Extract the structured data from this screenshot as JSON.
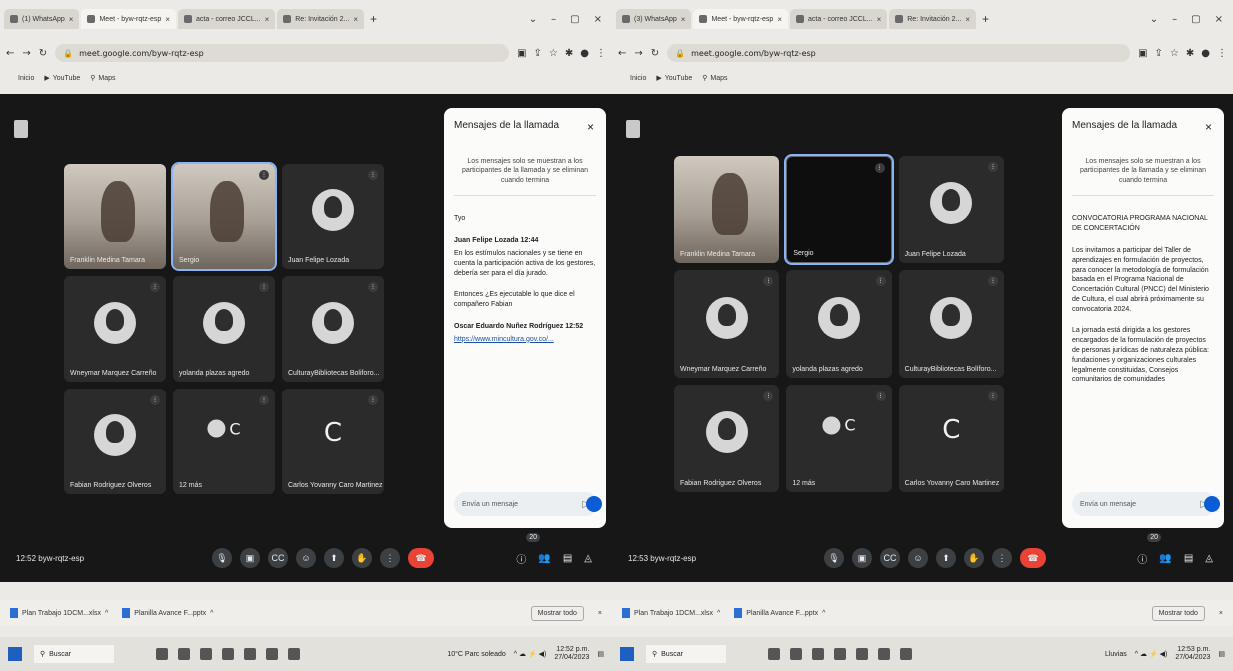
{
  "left": {
    "tabs": [
      {
        "label": "(1) WhatsApp"
      },
      {
        "label": "Meet - byw-rqtz-esp"
      },
      {
        "label": "acta - correo JCCL..."
      },
      {
        "label": "Re: Invitación 2..."
      }
    ],
    "url": "meet.google.com/byw-rqtz-esp",
    "bookmarks": [
      {
        "label": "Inicio"
      },
      {
        "label": "YouTube"
      },
      {
        "label": "Maps"
      }
    ],
    "participants": [
      {
        "name": "Franklin Medina Tamara",
        "kind": "video"
      },
      {
        "name": "Sergio",
        "kind": "video"
      },
      {
        "name": "Juan Felipe Lozada",
        "kind": "avatar"
      },
      {
        "name": "Wneymar Marquez Carreño",
        "kind": "avatar"
      },
      {
        "name": "yolanda plazas agredo",
        "kind": "avatar"
      },
      {
        "name": "CulturayBibliotecas Boliforo...",
        "kind": "avatar"
      },
      {
        "name": "Fabian Rodriguez Olveros",
        "kind": "avatar"
      },
      {
        "name": "12 más",
        "kind": "more",
        "letter": "C"
      },
      {
        "name": "Carlos Yovanny Caro Martinez",
        "kind": "letter",
        "letter": "C"
      }
    ],
    "chat": {
      "title": "Mensajes de la llamada",
      "notice": "Los mensajes solo se muestran a los participantes de la llamada y se eliminan cuando termina",
      "messages": [
        {
          "who": "",
          "text": "Tyo"
        },
        {
          "who": "Juan Felipe Lozada  12:44",
          "text": "En los estímulos nacionales y se tiene en cuenta la participación activa de los gestores, debería ser para el día jurado."
        },
        {
          "who": "",
          "text": "Entonces ¿Es ejecutable lo que dice el compañero Fabian"
        },
        {
          "who": "Oscar Eduardo Nuñez Rodríguez  12:52",
          "text": "https://www.mincultura.gov.co/..."
        }
      ],
      "input_placeholder": "Envía un mensaje"
    },
    "time": "12:52",
    "meeting_code": "byw-rqtz-esp",
    "people_count": "20",
    "downloads": [
      {
        "label": "Plan Trabajo 1DCM...xlsx"
      },
      {
        "label": "Planilla Avance F...pptx"
      }
    ],
    "downloads_more": "Mostrar todo",
    "search_label": "Buscar",
    "tray_status": "10°C Parc soleado",
    "clock_time": "12:52 p.m.",
    "clock_date": "27/04/2023"
  },
  "right": {
    "tabs": [
      {
        "label": "(3) WhatsApp"
      },
      {
        "label": "Meet - byw-rqtz-esp"
      },
      {
        "label": "acta - correo JCCL..."
      },
      {
        "label": "Re: Invitación 2..."
      }
    ],
    "url": "meet.google.com/byw-rqtz-esp",
    "bookmarks": [
      {
        "label": "Inicio"
      },
      {
        "label": "YouTube"
      },
      {
        "label": "Maps"
      }
    ],
    "participants": [
      {
        "name": "Franklin Medina Tamara",
        "kind": "video"
      },
      {
        "name": "Sergio",
        "kind": "black"
      },
      {
        "name": "Juan Felipe Lozada",
        "kind": "avatar"
      },
      {
        "name": "Wneymar Marquez Carreño",
        "kind": "avatar"
      },
      {
        "name": "yolanda plazas agredo",
        "kind": "avatar"
      },
      {
        "name": "CulturayBibliotecas Bolíforo...",
        "kind": "avatar"
      },
      {
        "name": "Fabian Rodriguez Olveros",
        "kind": "avatar"
      },
      {
        "name": "12 más",
        "kind": "more",
        "letter": "C"
      },
      {
        "name": "Carlos Yovanny Caro Martinez",
        "kind": "letter",
        "letter": "C"
      }
    ],
    "chat": {
      "title": "Mensajes de la llamada",
      "notice": "Los mensajes solo se muestran a los participantes de la llamada y se eliminan cuando termina",
      "messages": [
        {
          "who": "",
          "text": "CONVOCATORIA PROGRAMA NACIONAL DE CONCERTACIÓN"
        },
        {
          "who": "",
          "text": "Los invitamos a participar del Taller de aprendizajes en formulación de proyectos, para conocer la metodología de formulación basada en el Programa Nacional de Concertación Cultural (PNCC) del Ministerio de Cultura, el cual abrirá próximamente su convocatoria 2024."
        },
        {
          "who": "",
          "text": "La jornada está dirigida a los gestores encargados de la formulación de proyectos de personas jurídicas de naturaleza pública: fundaciones y organizaciones culturales legalmente constituidas, Consejos comunitarios de comunidades"
        }
      ],
      "input_placeholder": "Envía un mensaje"
    },
    "time": "12:53",
    "meeting_code": "byw-rqtz-esp",
    "people_count": "20",
    "downloads": [
      {
        "label": "Plan Trabajo 1DCM...xlsx"
      },
      {
        "label": "Planilla Avance F...pptx"
      }
    ],
    "downloads_more": "Mostrar todo",
    "search_label": "Buscar",
    "tray_status": "Lluvias",
    "clock_time": "12:53 p.m.",
    "clock_date": "27/04/2023"
  }
}
